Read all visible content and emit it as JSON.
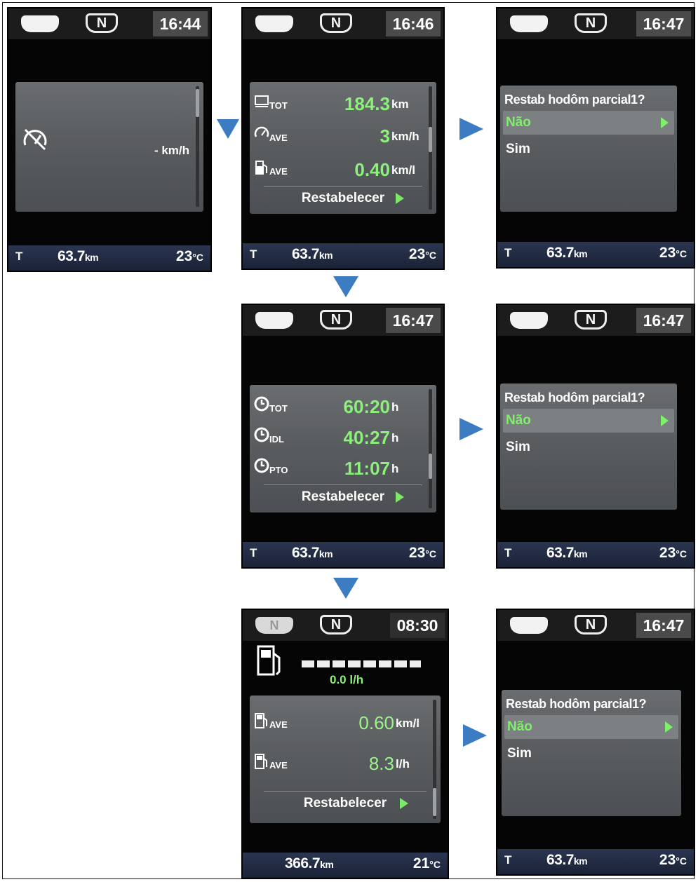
{
  "colors": {
    "arrow": "#3c7cc2",
    "value_green": "#8cf07a",
    "panel_gray": "#5a5d60"
  },
  "icons": [
    "speedometer-off-icon",
    "odometer-icon",
    "average-speed-icon",
    "fuel-pump-icon",
    "engine-hours-clock-icon",
    "reset-arrow-icon",
    "flow-arrow-icon"
  ],
  "screen1": {
    "gear": "N",
    "time": "16:44",
    "speed_value": "- km/h",
    "bottom": {
      "t": "T",
      "odo_value": "63.7",
      "odo_unit": "km",
      "temp_value": "23",
      "temp_unit": "°C"
    }
  },
  "screen2": {
    "gear": "N",
    "time": "16:46",
    "rows": [
      {
        "sub": "TOT",
        "value": "184.3",
        "unit": "km"
      },
      {
        "sub": "AVE",
        "value": "3",
        "unit": "km/h"
      },
      {
        "sub": "AVE",
        "value": "0.40",
        "unit": "km/l"
      }
    ],
    "reset": "Restabelecer",
    "bottom": {
      "t": "T",
      "odo_value": "63.7",
      "odo_unit": "km",
      "temp_value": "23",
      "temp_unit": "°C"
    }
  },
  "screen3": {
    "gear": "N",
    "time": "16:47",
    "question": "Restab hodôm parcial1?",
    "option_no": "Não",
    "option_yes": "Sim",
    "bottom": {
      "t": "T",
      "odo_value": "63.7",
      "odo_unit": "km",
      "temp_value": "23",
      "temp_unit": "°C"
    }
  },
  "screen4": {
    "gear": "N",
    "time": "16:47",
    "rows": [
      {
        "sub": "TOT",
        "value": "60:20",
        "unit": "h"
      },
      {
        "sub": "IDL",
        "value": "40:27",
        "unit": "h"
      },
      {
        "sub": "PTO",
        "value": "11:07",
        "unit": "h"
      }
    ],
    "reset": "Restabelecer",
    "bottom": {
      "t": "T",
      "odo_value": "63.7",
      "odo_unit": "km",
      "temp_value": "23",
      "temp_unit": "°C"
    }
  },
  "screen5": {
    "gear": "N",
    "time": "16:47",
    "question": "Restab hodôm parcial1?",
    "option_no": "Não",
    "option_yes": "Sim",
    "bottom": {
      "t": "T",
      "odo_value": "63.7",
      "odo_unit": "km",
      "temp_value": "23",
      "temp_unit": "°C"
    }
  },
  "screen6": {
    "lamp": "N",
    "gear": "N",
    "time": "08:30",
    "instant_fuel": "0.0 l/h",
    "rows": [
      {
        "sub": "AVE",
        "value": "0.60",
        "unit": "km/l"
      },
      {
        "sub": "AVE",
        "value": "8.3",
        "unit": "l/h"
      }
    ],
    "reset": "Restabelecer",
    "bottom": {
      "odo_value": "366.7",
      "odo_unit": "km",
      "temp_value": "21",
      "temp_unit": "°C"
    }
  },
  "screen7": {
    "gear": "N",
    "time": "16:47",
    "question": "Restab hodôm parcial1?",
    "option_no": "Não",
    "option_yes": "Sim",
    "bottom": {
      "t": "T",
      "odo_value": "63.7",
      "odo_unit": "km",
      "temp_value": "23",
      "temp_unit": "°C"
    }
  }
}
